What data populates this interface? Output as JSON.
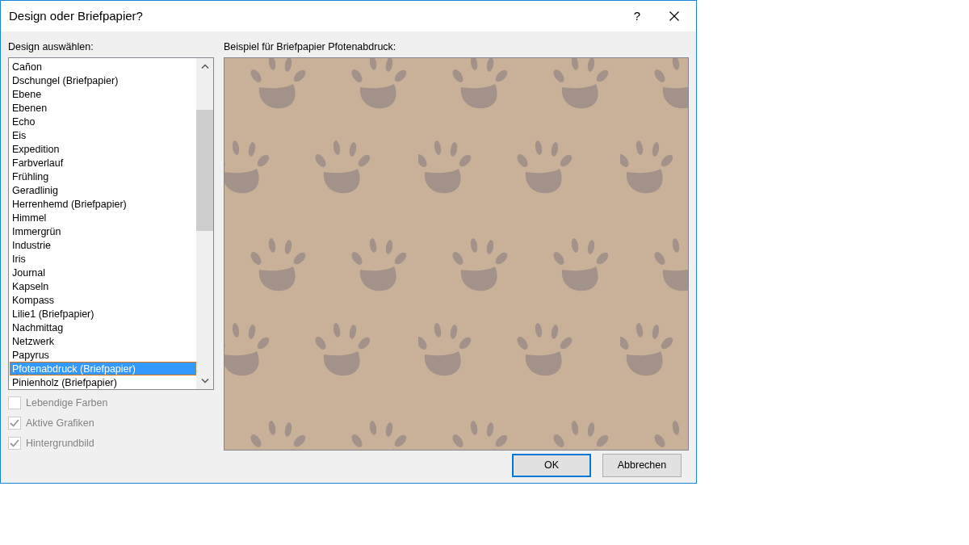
{
  "window": {
    "title": "Design oder Briefpapier?",
    "help_button": "?"
  },
  "design_list": {
    "label": "Design auswählen:",
    "items": [
      {
        "label": "Cañon",
        "selected": false
      },
      {
        "label": "Dschungel (Briefpapier)",
        "selected": false
      },
      {
        "label": "Ebene",
        "selected": false
      },
      {
        "label": "Ebenen",
        "selected": false
      },
      {
        "label": "Echo",
        "selected": false
      },
      {
        "label": "Eis",
        "selected": false
      },
      {
        "label": "Expedition",
        "selected": false
      },
      {
        "label": "Farbverlauf",
        "selected": false
      },
      {
        "label": "Frühling",
        "selected": false
      },
      {
        "label": "Geradlinig",
        "selected": false
      },
      {
        "label": "Herrenhemd (Briefpapier)",
        "selected": false
      },
      {
        "label": "Himmel",
        "selected": false
      },
      {
        "label": "Immergrün",
        "selected": false
      },
      {
        "label": "Industrie",
        "selected": false
      },
      {
        "label": "Iris",
        "selected": false
      },
      {
        "label": "Journal",
        "selected": false
      },
      {
        "label": "Kapseln",
        "selected": false
      },
      {
        "label": "Kompass",
        "selected": false
      },
      {
        "label": "Lilie1 (Briefpapier)",
        "selected": false
      },
      {
        "label": "Nachmittag",
        "selected": false
      },
      {
        "label": "Netzwerk",
        "selected": false
      },
      {
        "label": "Papyrus",
        "selected": false
      },
      {
        "label": "Pfotenabdruck (Briefpapier)",
        "selected": true
      },
      {
        "label": "Pinienholz (Briefpapier)",
        "selected": false
      }
    ]
  },
  "options": [
    {
      "label": "Lebendige Farben",
      "checked": false,
      "disabled": true
    },
    {
      "label": "Aktive Grafiken",
      "checked": true,
      "disabled": true
    },
    {
      "label": "Hintergrundbild",
      "checked": true,
      "disabled": true
    }
  ],
  "preview": {
    "label": "Beispiel für Briefpapier Pfotenabdruck:"
  },
  "buttons": [
    {
      "label": "OK",
      "default": true
    },
    {
      "label": "Abbrechen",
      "default": false
    }
  ]
}
